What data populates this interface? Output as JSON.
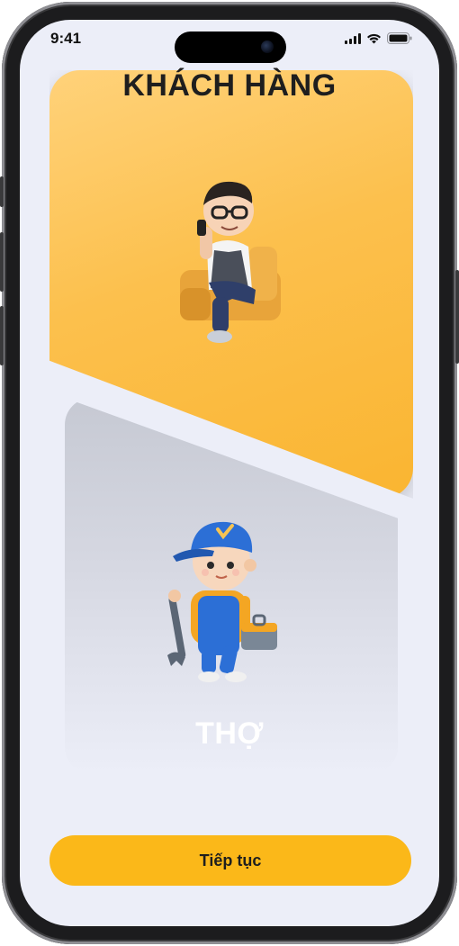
{
  "status_bar": {
    "time": "9:41",
    "icons": [
      "cellular-signal-icon",
      "wifi-icon",
      "battery-icon"
    ]
  },
  "role_options": [
    {
      "id": "customer",
      "title": "KHÁCH HÀNG",
      "illustration": "customer-avatar-illustration",
      "color": "#fbb829"
    },
    {
      "id": "worker",
      "title": "THỢ",
      "illustration": "worker-avatar-illustration",
      "color": "#c9ccd6"
    }
  ],
  "actions": {
    "continue_label": "Tiếp tục",
    "accent": "#fbb819"
  }
}
